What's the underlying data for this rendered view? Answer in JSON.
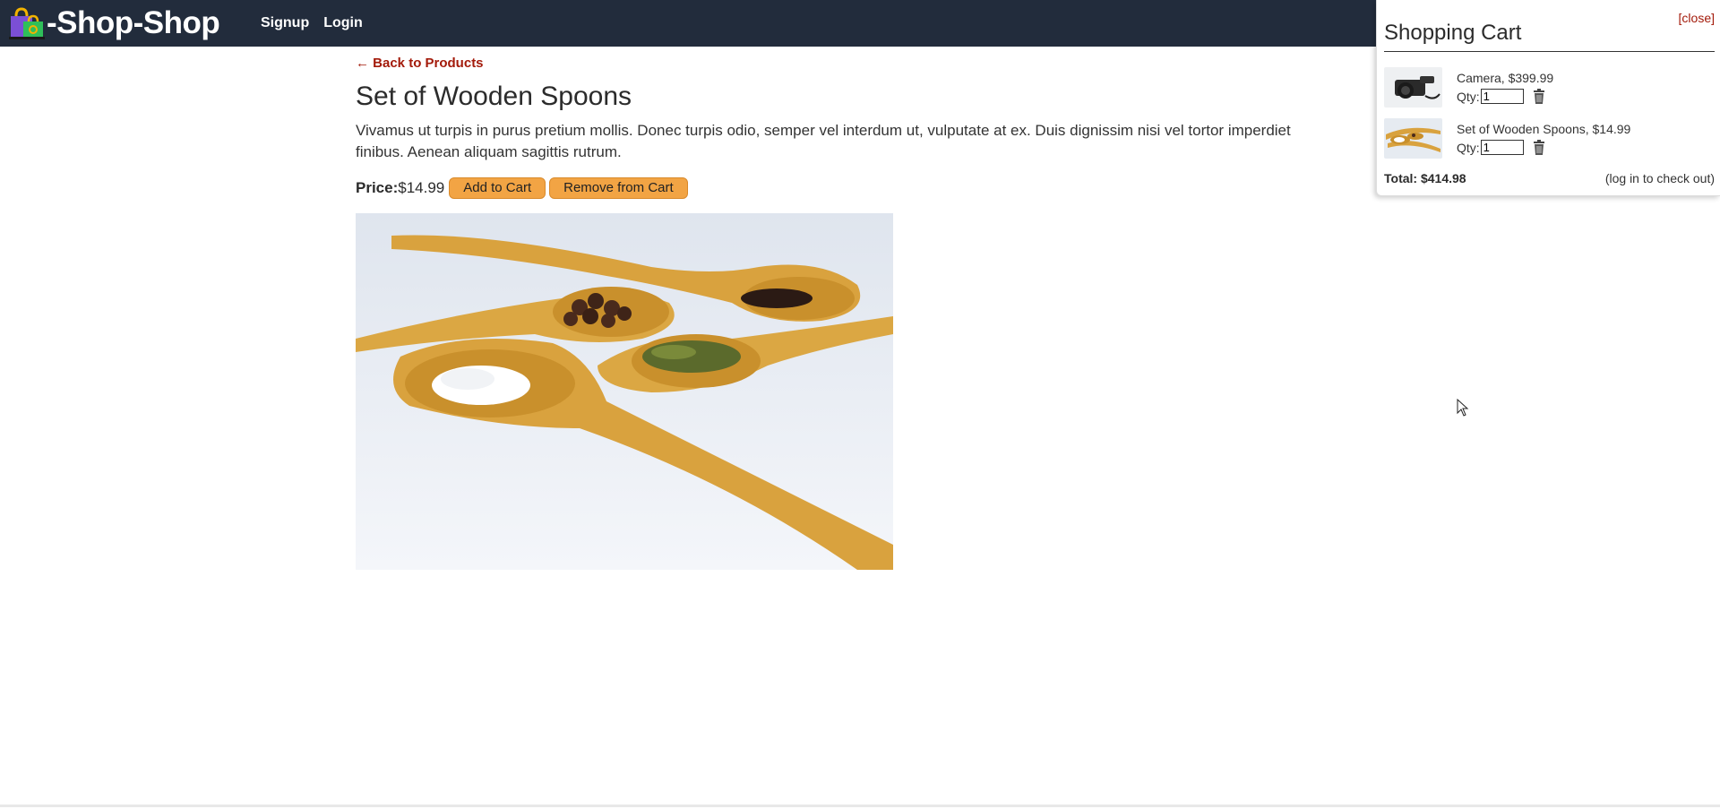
{
  "header": {
    "brand": "-Shop-Shop",
    "nav": {
      "signup": "Signup",
      "login": "Login"
    }
  },
  "product": {
    "back_link": "← Back to Products",
    "title": "Set of Wooden Spoons",
    "description": "Vivamus ut turpis in purus pretium mollis. Donec turpis odio, semper vel interdum ut, vulputate at ex. Duis dignissim nisi vel tortor imperdiet finibus. Aenean aliquam sagittis rutrum.",
    "price_label": "Price:",
    "price": "$14.99",
    "add_button": "Add to Cart",
    "remove_button": "Remove from Cart"
  },
  "cart": {
    "close": "[close]",
    "title": "Shopping Cart",
    "qty_label": "Qty:",
    "items": [
      {
        "name": "Camera, $399.99",
        "qty": "1"
      },
      {
        "name": "Set of Wooden Spoons, $14.99",
        "qty": "1"
      }
    ],
    "total": "Total: $414.98",
    "checkout_note": "(log in to check out)"
  },
  "colors": {
    "header_bg": "#222c3c",
    "link_red": "#a31a0a",
    "button_orange": "#f2a444"
  },
  "icons": [
    "shopping-bag-logo-icon",
    "trash-icon",
    "mouse-cursor-icon"
  ]
}
